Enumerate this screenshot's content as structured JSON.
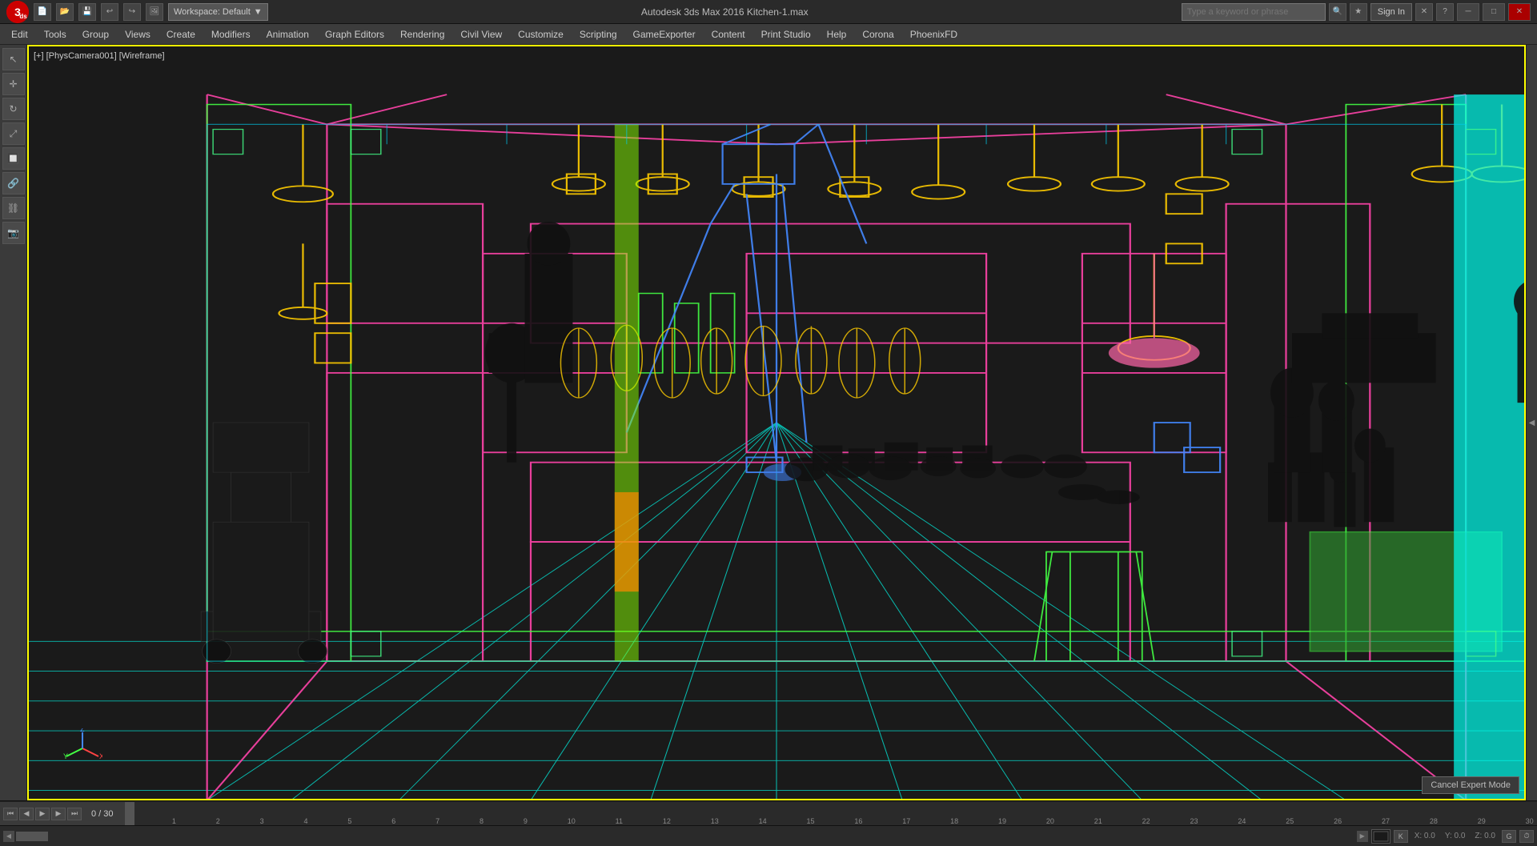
{
  "titlebar": {
    "app_logo": "3",
    "workspace_label": "Workspace: Default",
    "title": "Autodesk 3ds Max 2016    Kitchen-1.max",
    "search_placeholder": "Type a keyword or phrase",
    "sign_in": "Sign In",
    "minimize": "─",
    "maximize": "□",
    "close": "✕"
  },
  "menubar": {
    "items": [
      "Edit",
      "Tools",
      "Group",
      "Views",
      "Create",
      "Modifiers",
      "Animation",
      "Graph Editors",
      "Rendering",
      "Civil View",
      "Customize",
      "Scripting",
      "GameExporter",
      "Content",
      "Print Studio",
      "Help",
      "Corona",
      "PhoenixFD"
    ]
  },
  "viewport": {
    "label": "[+] [PhysCamera001] [Wireframe]",
    "expert_mode_btn": "Cancel Expert Mode"
  },
  "timeline": {
    "frame_current": "0",
    "frame_total": "30",
    "frame_display": "0 / 30"
  },
  "statusbar": {
    "text": ""
  },
  "axis": {
    "x": "X",
    "y": "Y",
    "z": "Z"
  }
}
